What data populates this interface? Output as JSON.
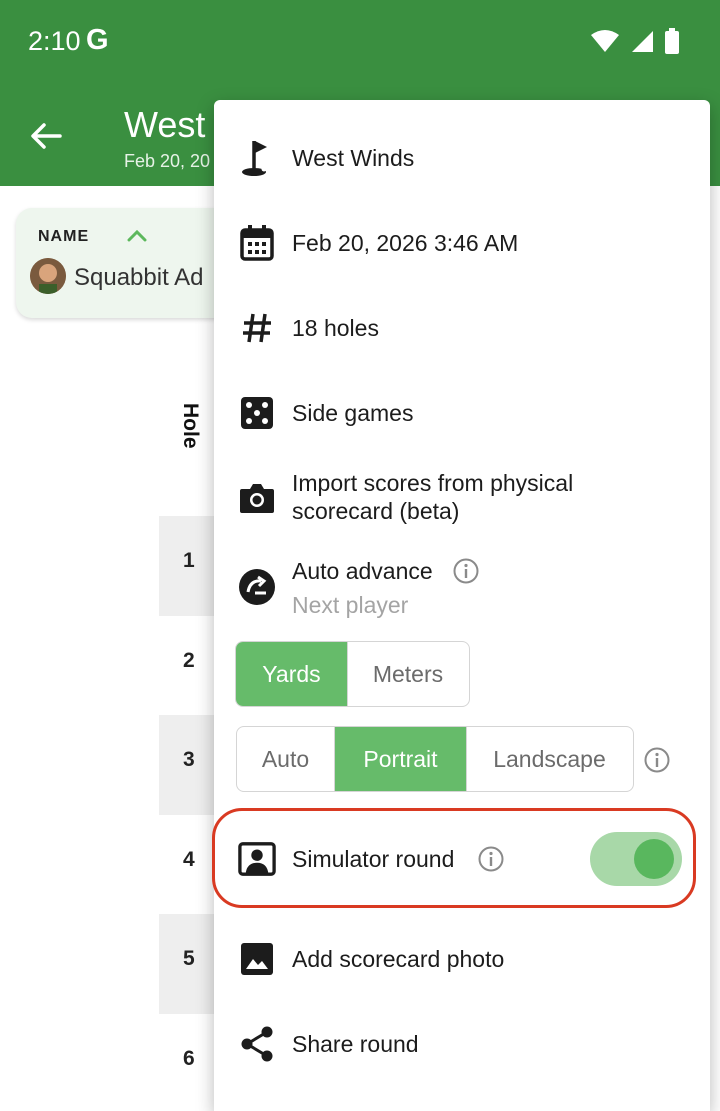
{
  "status_bar": {
    "time": "2:10",
    "g_label": "G"
  },
  "app_bar": {
    "title": "West",
    "subtitle": "Feb 20, 20"
  },
  "player_card": {
    "header": "NAME",
    "player_name": "Squabbit Ad"
  },
  "scorecard": {
    "hole_header": "Hole",
    "holes": [
      "1",
      "2",
      "3",
      "4",
      "5",
      "6"
    ]
  },
  "menu": {
    "course": "West Winds",
    "datetime": "Feb 20, 2026 3:46 AM",
    "holes": "18 holes",
    "side_games": "Side games",
    "import_line1": "Import scores from physical",
    "import_line2": "scorecard (beta)",
    "auto_advance": "Auto advance",
    "auto_advance_sub": "Next player",
    "units": {
      "yards": "Yards",
      "meters": "Meters",
      "selected": "Yards"
    },
    "orientation": {
      "auto": "Auto",
      "portrait": "Portrait",
      "landscape": "Landscape",
      "selected": "Portrait"
    },
    "simulator_round": "Simulator round",
    "simulator_round_enabled": true,
    "add_photo": "Add scorecard photo",
    "share_round": "Share round"
  },
  "colors": {
    "primary": "#3a8f40",
    "accent": "#66bb6a",
    "highlight": "#d93a22"
  },
  "icons": [
    "golf-flag-icon",
    "calendar-icon",
    "hash-icon",
    "dice-icon",
    "camera-icon",
    "auto-advance-icon",
    "info-icon",
    "person-card-icon",
    "image-icon",
    "share-icon"
  ]
}
